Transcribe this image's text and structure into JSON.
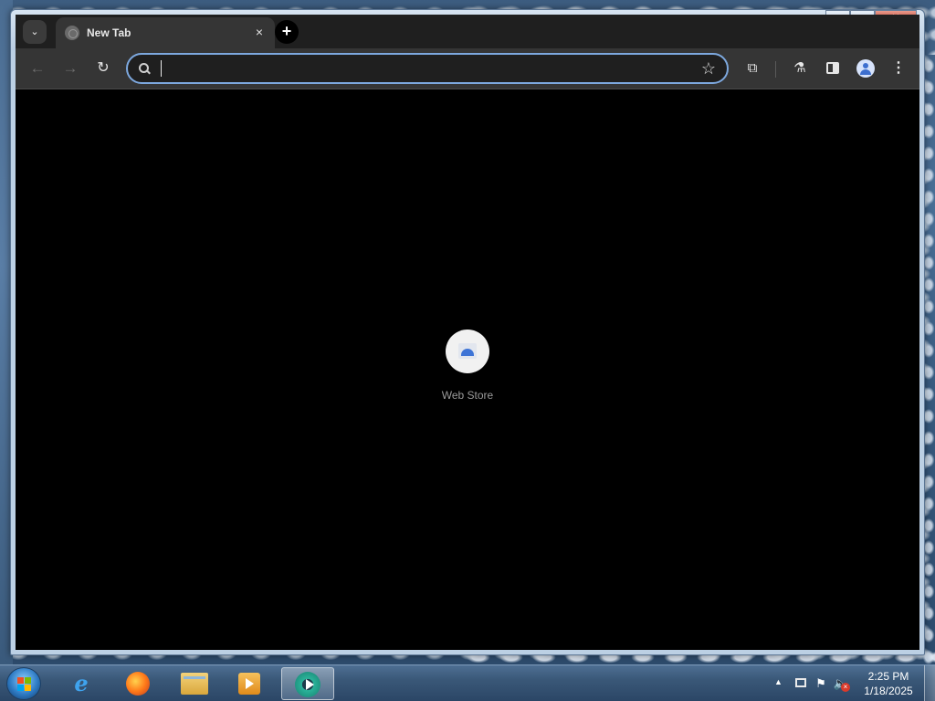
{
  "browser": {
    "tab": {
      "title": "New Tab",
      "close_glyph": "×"
    },
    "new_tab_glyph": "+",
    "tab_search_glyph": "⌄",
    "window_controls": {
      "minimize": "–",
      "maximize": "□",
      "close": "✕"
    },
    "toolbar": {
      "back_glyph": "←",
      "forward_glyph": "→",
      "reload_glyph": "↻",
      "omnibox_value": "",
      "bookmark_glyph": "☆",
      "extensions_glyph": "⧉",
      "labs_glyph": "⚗",
      "menu_glyph": "⋮"
    },
    "accent_color": "#7da8de"
  },
  "new_tab_page": {
    "shortcuts": [
      {
        "label": "Web Store",
        "icon": "web-store-icon"
      }
    ]
  },
  "taskbar": {
    "pinned": [
      {
        "name": "internet-explorer",
        "icon": "ie-icon",
        "glyph": "e"
      },
      {
        "name": "firefox",
        "icon": "firefox-icon",
        "glyph": ""
      },
      {
        "name": "file-explorer",
        "icon": "folder-icon",
        "glyph": ""
      },
      {
        "name": "media-player",
        "icon": "media-player-icon",
        "glyph": ""
      },
      {
        "name": "active-app",
        "icon": "play-circle-icon",
        "glyph": "",
        "active": true
      }
    ],
    "tray": {
      "overflow_glyph": "▲",
      "flag_glyph": "⚑",
      "volume_glyph": "🔈",
      "volume_muted_glyph": "×",
      "time": "2:25 PM",
      "date": "1/18/2025"
    }
  }
}
